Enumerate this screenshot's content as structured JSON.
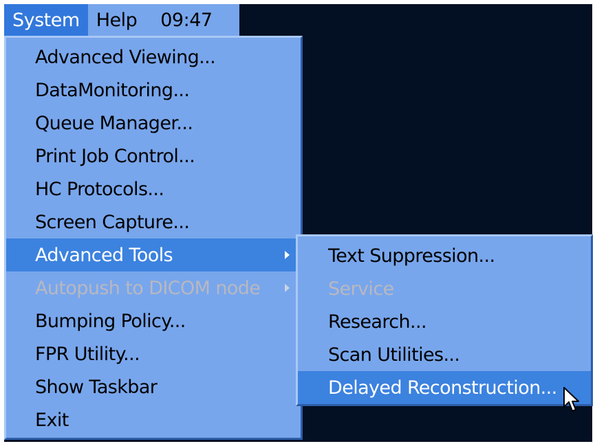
{
  "menubar": {
    "items": [
      {
        "label": "System",
        "active": true
      },
      {
        "label": "Help",
        "active": false
      }
    ],
    "clock": "09:47"
  },
  "system_menu": {
    "items": [
      {
        "label": "Advanced Viewing...",
        "state": "normal",
        "submenu": false
      },
      {
        "label": "DataMonitoring...",
        "state": "normal",
        "submenu": false
      },
      {
        "label": "Queue Manager...",
        "state": "normal",
        "submenu": false
      },
      {
        "label": "Print Job Control...",
        "state": "normal",
        "submenu": false
      },
      {
        "label": "HC Protocols...",
        "state": "normal",
        "submenu": false
      },
      {
        "label": "Screen Capture...",
        "state": "normal",
        "submenu": false
      },
      {
        "label": "Advanced Tools",
        "state": "highlighted",
        "submenu": true
      },
      {
        "label": "Autopush to DICOM node",
        "state": "disabled",
        "submenu": true
      },
      {
        "label": "Bumping Policy...",
        "state": "normal",
        "submenu": false
      },
      {
        "label": "FPR Utility...",
        "state": "normal",
        "submenu": false
      },
      {
        "label": "Show Taskbar",
        "state": "normal",
        "submenu": false
      },
      {
        "label": "Exit",
        "state": "normal",
        "submenu": false
      }
    ]
  },
  "advanced_tools_submenu": {
    "items": [
      {
        "label": "Text Suppression...",
        "state": "normal"
      },
      {
        "label": "Service",
        "state": "disabled"
      },
      {
        "label": "Research...",
        "state": "normal"
      },
      {
        "label": "Scan Utilities...",
        "state": "normal"
      },
      {
        "label": "Delayed Reconstruction...",
        "state": "highlighted"
      }
    ]
  },
  "colors": {
    "desktop": "#030f22",
    "menu_bg": "#78a6ec",
    "highlight": "#3c82df",
    "disabled_text": "#b8b8c0"
  },
  "icons": {
    "submenu_arrow": "chevron-right-icon",
    "pointer": "mouse-cursor-icon"
  }
}
